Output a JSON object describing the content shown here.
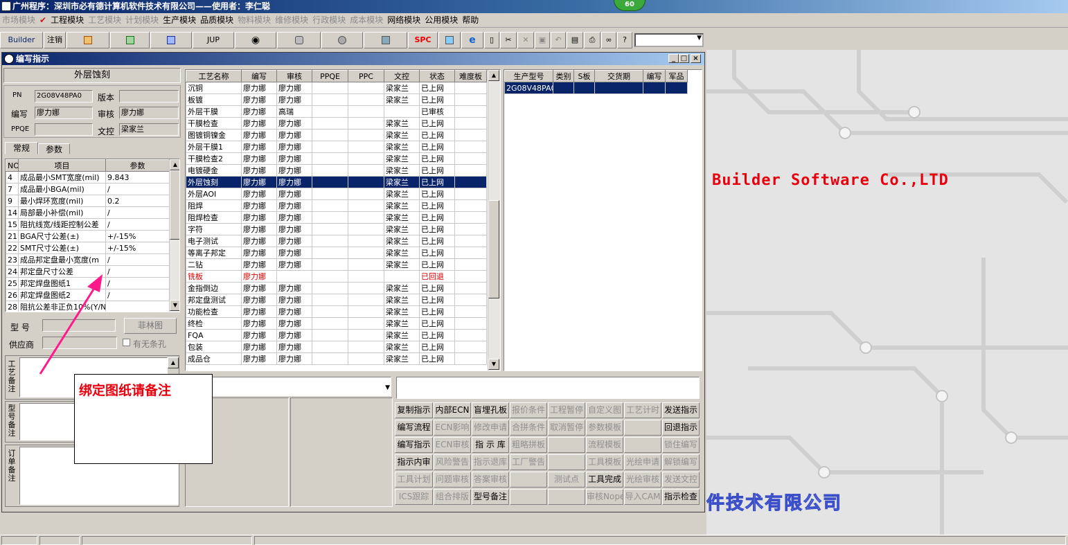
{
  "app_title": "广州程序：深圳市必有德计算机软件技术有限公司——使用者：李仁聪",
  "badge": "60",
  "menu": [
    {
      "label": "市场模块",
      "enabled": false
    },
    {
      "label": "✔",
      "enabled": true
    },
    {
      "label": "工程模块",
      "enabled": true
    },
    {
      "label": "工艺模块",
      "enabled": false
    },
    {
      "label": "计划模块",
      "enabled": false
    },
    {
      "label": "生产模块",
      "enabled": true
    },
    {
      "label": "品质模块",
      "enabled": true
    },
    {
      "label": "物料模块",
      "enabled": false
    },
    {
      "label": "维修模块",
      "enabled": false
    },
    {
      "label": "行政模块",
      "enabled": false
    },
    {
      "label": "成本模块",
      "enabled": false
    },
    {
      "label": "网络模块",
      "enabled": true
    },
    {
      "label": "公用模块",
      "enabled": true
    },
    {
      "label": "帮助",
      "enabled": true
    }
  ],
  "toolbar": {
    "builder": "Builder",
    "logout": "注销",
    "jup": "JUP",
    "spc": "SPC"
  },
  "desktop": {
    "brand_en": "Builder Software Co.,LTD",
    "brand_cn": "件技术有限公司"
  },
  "window": {
    "title": "编写指示"
  },
  "left": {
    "process_name": "外层蚀刻",
    "pn_label": "PN",
    "pn": "2G08V48PA0",
    "version_label": "版本",
    "version": "",
    "writer_label": "编写",
    "writer": "廖力娜",
    "reviewer_label": "审核",
    "reviewer": "廖力娜",
    "ppqe_label": "PPQE",
    "ppqe": "",
    "doc_label": "文控",
    "doc": "梁家兰",
    "tabs": [
      "常规",
      "参数"
    ],
    "param_headers": [
      "NO",
      "项目",
      "参数"
    ],
    "params": [
      [
        "4",
        "成品最小SMT宽度(mil)",
        "9.843"
      ],
      [
        "7",
        "成品最小BGA(mil)",
        "/"
      ],
      [
        "9",
        "最小焊环宽度(mil)",
        "0.2"
      ],
      [
        "14",
        "局部最小补偿(mil)",
        "/"
      ],
      [
        "15",
        "阻抗线宽/线距控制公差",
        "/"
      ],
      [
        "21",
        "BGA尺寸公差(±)",
        "+/-15%"
      ],
      [
        "22",
        "SMT尺寸公差(±)",
        "+/-15%"
      ],
      [
        "23",
        "成品邦定盘最小宽度(m",
        "/"
      ],
      [
        "24",
        "邦定盘尺寸公差",
        "/"
      ],
      [
        "25",
        "邦定焊盘图纸1",
        "/"
      ],
      [
        "26",
        "邦定焊盘图纸2",
        "/"
      ],
      [
        "28",
        "阻抗公差非正负10%(Y/N",
        ""
      ]
    ],
    "model_label": "型 号",
    "model": "",
    "film_btn": "菲林图",
    "supplier_label": "供应商",
    "supplier": "",
    "hole_label": "有无条孔",
    "remark1": "工艺备注",
    "remark2": "型号备注",
    "remark3": "订单备注"
  },
  "callout": "绑定图纸请备注",
  "process_headers": [
    "工艺名称",
    "编写",
    "审核",
    "PPQE",
    "PPC",
    "文控",
    "状态",
    "难度板"
  ],
  "processes": [
    [
      "沉铜",
      "廖力娜",
      "廖力娜",
      "",
      "",
      "梁家兰",
      "已上网",
      ""
    ],
    [
      "板镀",
      "廖力娜",
      "廖力娜",
      "",
      "",
      "梁家兰",
      "已上网",
      ""
    ],
    [
      "外层干膜",
      "廖力娜",
      "高瑞",
      "",
      "",
      "",
      "已审核",
      ""
    ],
    [
      "干膜检查",
      "廖力娜",
      "廖力娜",
      "",
      "",
      "梁家兰",
      "已上网",
      ""
    ],
    [
      "图镀铜镍金",
      "廖力娜",
      "廖力娜",
      "",
      "",
      "梁家兰",
      "已上网",
      ""
    ],
    [
      "外层干膜1",
      "廖力娜",
      "廖力娜",
      "",
      "",
      "梁家兰",
      "已上网",
      ""
    ],
    [
      "干膜检查2",
      "廖力娜",
      "廖力娜",
      "",
      "",
      "梁家兰",
      "已上网",
      ""
    ],
    [
      "电镀硬金",
      "廖力娜",
      "廖力娜",
      "",
      "",
      "梁家兰",
      "已上网",
      ""
    ],
    [
      "外层蚀刻",
      "廖力娜",
      "廖力娜",
      "",
      "",
      "梁家兰",
      "已上网",
      ""
    ],
    [
      "外层AOI",
      "廖力娜",
      "廖力娜",
      "",
      "",
      "梁家兰",
      "已上网",
      ""
    ],
    [
      "阻焊",
      "廖力娜",
      "廖力娜",
      "",
      "",
      "梁家兰",
      "已上网",
      ""
    ],
    [
      "阻焊检查",
      "廖力娜",
      "廖力娜",
      "",
      "",
      "梁家兰",
      "已上网",
      ""
    ],
    [
      "字符",
      "廖力娜",
      "廖力娜",
      "",
      "",
      "梁家兰",
      "已上网",
      ""
    ],
    [
      "电子测试",
      "廖力娜",
      "廖力娜",
      "",
      "",
      "梁家兰",
      "已上网",
      ""
    ],
    [
      "等离子邦定",
      "廖力娜",
      "廖力娜",
      "",
      "",
      "梁家兰",
      "已上网",
      ""
    ],
    [
      "二钻",
      "廖力娜",
      "廖力娜",
      "",
      "",
      "梁家兰",
      "已上网",
      ""
    ],
    [
      "铣板",
      "廖力娜",
      "",
      "",
      "",
      "",
      "已回退",
      ""
    ],
    [
      "金指倒边",
      "廖力娜",
      "廖力娜",
      "",
      "",
      "梁家兰",
      "已上网",
      ""
    ],
    [
      "邦定盘测试",
      "廖力娜",
      "廖力娜",
      "",
      "",
      "梁家兰",
      "已上网",
      ""
    ],
    [
      "功能检查",
      "廖力娜",
      "廖力娜",
      "",
      "",
      "梁家兰",
      "已上网",
      ""
    ],
    [
      "终检",
      "廖力娜",
      "廖力娜",
      "",
      "",
      "梁家兰",
      "已上网",
      ""
    ],
    [
      "FQA",
      "廖力娜",
      "廖力娜",
      "",
      "",
      "梁家兰",
      "已上网",
      ""
    ],
    [
      "包装",
      "廖力娜",
      "廖力娜",
      "",
      "",
      "梁家兰",
      "已上网",
      ""
    ],
    [
      "成品仓",
      "廖力娜",
      "廖力娜",
      "",
      "",
      "梁家兰",
      "已上网",
      ""
    ]
  ],
  "selected_process": 8,
  "returned_process": 16,
  "model_headers": [
    "生产型号",
    "类别",
    "S板",
    "交货期",
    "编写",
    "军品"
  ],
  "models": [
    [
      "2G08V48PA0",
      "",
      "",
      "",
      "",
      ""
    ]
  ],
  "buttons": [
    [
      {
        "t": "复制指示",
        "on": true
      },
      {
        "t": "内部ECN",
        "on": true
      },
      {
        "t": "盲埋孔板",
        "on": true
      },
      {
        "t": "报价条件",
        "on": false
      },
      {
        "t": "工程暂停",
        "on": false
      },
      {
        "t": "自定义图",
        "on": false
      },
      {
        "t": "工艺计时",
        "on": false
      },
      {
        "t": "发送指示",
        "on": true
      }
    ],
    [
      {
        "t": "编写流程",
        "on": true
      },
      {
        "t": "ECN影响",
        "on": false
      },
      {
        "t": "修改申请",
        "on": false
      },
      {
        "t": "合拼条件",
        "on": false
      },
      {
        "t": "取消暂停",
        "on": false
      },
      {
        "t": "参数模板",
        "on": false
      },
      {
        "t": "",
        "on": false
      },
      {
        "t": "回退指示",
        "on": true
      }
    ],
    [
      {
        "t": "编写指示",
        "on": true
      },
      {
        "t": "ECN审核",
        "on": false
      },
      {
        "t": "指 示 库",
        "on": true
      },
      {
        "t": "粗略拼板",
        "on": false
      },
      {
        "t": "",
        "on": false
      },
      {
        "t": "流程模板",
        "on": false
      },
      {
        "t": "",
        "on": false
      },
      {
        "t": "锁住编写",
        "on": false
      }
    ],
    [
      {
        "t": "指示内审",
        "on": true
      },
      {
        "t": "风险警告",
        "on": false
      },
      {
        "t": "指示退库",
        "on": false
      },
      {
        "t": "工厂警告",
        "on": false
      },
      {
        "t": "",
        "on": false
      },
      {
        "t": "工具模板",
        "on": false
      },
      {
        "t": "光绘申请",
        "on": false
      },
      {
        "t": "解锁编写",
        "on": false
      }
    ],
    [
      {
        "t": "工具计划",
        "on": false
      },
      {
        "t": "问题审核",
        "on": false
      },
      {
        "t": "答案审核",
        "on": false
      },
      {
        "t": "",
        "on": false
      },
      {
        "t": "测试点",
        "on": false
      },
      {
        "t": "工具完成",
        "on": true
      },
      {
        "t": "光绘审核",
        "on": false
      },
      {
        "t": "发送文控",
        "on": false
      }
    ],
    [
      {
        "t": "ICS跟踪",
        "on": false
      },
      {
        "t": "组合排版",
        "on": false
      },
      {
        "t": "型号备注",
        "on": true
      },
      {
        "t": "",
        "on": false
      },
      {
        "t": "",
        "on": false
      },
      {
        "t": "审核Nope",
        "on": false
      },
      {
        "t": "导入CAM",
        "on": false
      },
      {
        "t": "指示检查",
        "on": true
      }
    ]
  ],
  "colors": {
    "title_blue": "#0a246a",
    "selection": "#0a246a",
    "accent_red": "#e8000f",
    "callout_arrow": "#ff1a8c"
  }
}
